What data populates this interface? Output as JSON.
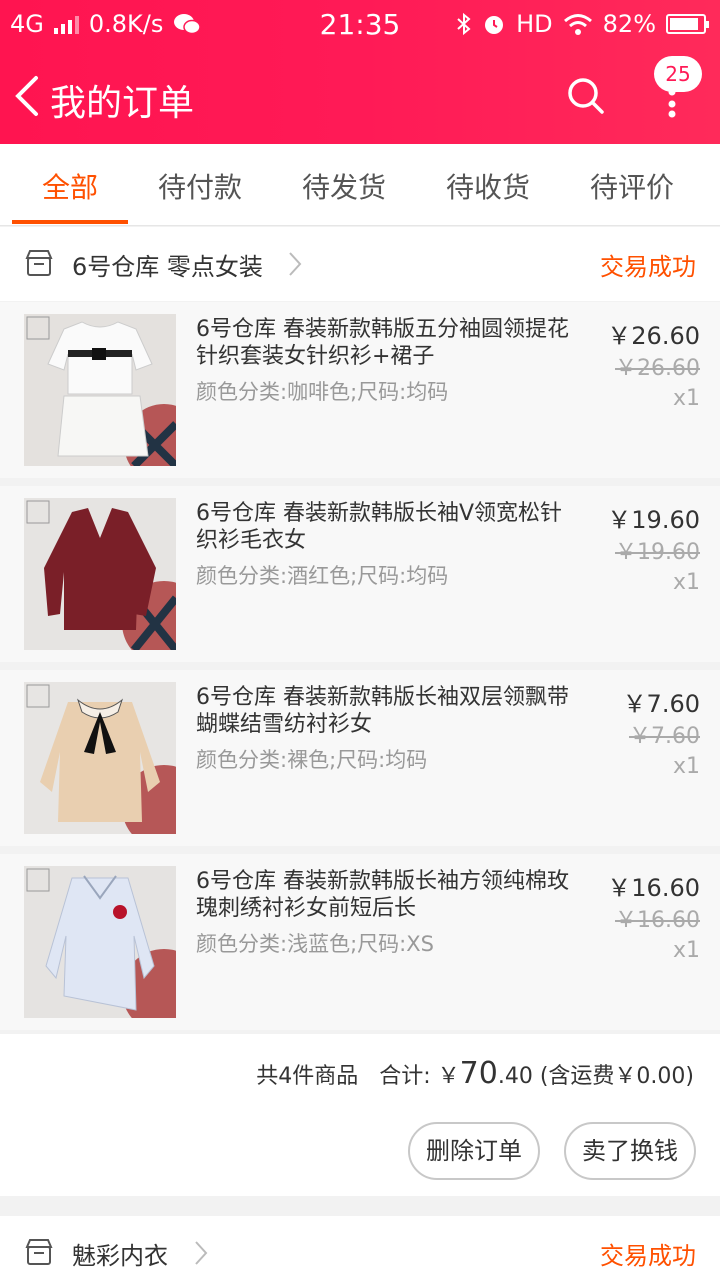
{
  "status_bar": {
    "network": "4G",
    "speed": "0.8K/s",
    "time": "21:35",
    "hd": "HD",
    "battery": "82%"
  },
  "header": {
    "title": "我的订单",
    "badge_count": "25"
  },
  "tabs": [
    {
      "label": "全部",
      "active": true
    },
    {
      "label": "待付款",
      "active": false
    },
    {
      "label": "待发货",
      "active": false
    },
    {
      "label": "待收货",
      "active": false
    },
    {
      "label": "待评价",
      "active": false
    }
  ],
  "orders": [
    {
      "shop_name": "6号仓库 零点女装",
      "status": "交易成功",
      "items": [
        {
          "name": "6号仓库 春装新款韩版五分袖圆领提花针织套装女针织衫+裙子",
          "sku": "颜色分类:咖啡色;尺码:均码",
          "price": "￥26.60",
          "orig_price": "￥26.60",
          "qty": "x1"
        },
        {
          "name": "6号仓库 春装新款韩版长袖V领宽松针织衫毛衣女",
          "sku": "颜色分类:酒红色;尺码:均码",
          "price": "￥19.60",
          "orig_price": "￥19.60",
          "qty": "x1"
        },
        {
          "name": "6号仓库 春装新款韩版长袖双层领飘带蝴蝶结雪纺衬衫女",
          "sku": "颜色分类:裸色;尺码:均码",
          "price": "￥7.60",
          "orig_price": "￥7.60",
          "qty": "x1"
        },
        {
          "name": "6号仓库 春装新款韩版长袖方领纯棉玫瑰刺绣衬衫女前短后长",
          "sku": "颜色分类:浅蓝色;尺码:XS",
          "price": "￥16.60",
          "orig_price": "￥16.60",
          "qty": "x1"
        }
      ],
      "summary": {
        "count_text": "共4件商品",
        "total_label": "合计:",
        "currency": "￥",
        "total_int": "70",
        "total_dec": ".40",
        "shipping_text": "(含运费￥0.00)"
      },
      "buttons": {
        "delete": "删除订单",
        "resell": "卖了换钱"
      }
    },
    {
      "shop_name": "魅彩内衣",
      "status": "交易成功"
    }
  ],
  "colors": {
    "header_bg": "#ff1a56",
    "accent": "#ff5000"
  }
}
